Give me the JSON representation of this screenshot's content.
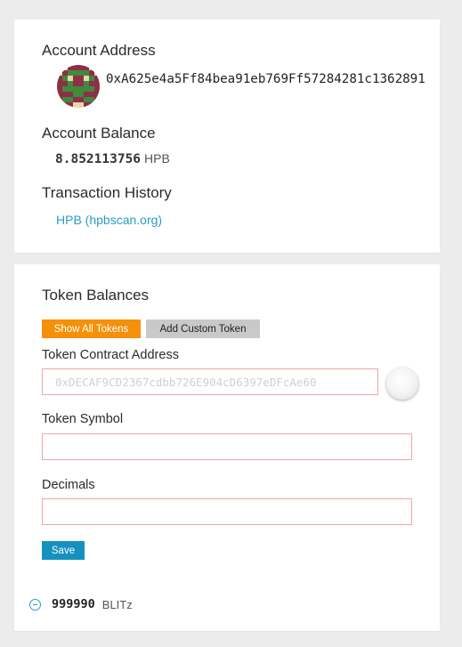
{
  "account": {
    "address_heading": "Account Address",
    "address": "0xA625e4a5Ff84bea91eb769Ff57284281c1362891",
    "balance_heading": "Account Balance",
    "balance_value": "8.852113756",
    "balance_unit": "HPB",
    "history_heading": "Transaction History",
    "history_link": "HPB (hpbscan.org)",
    "avatar_colors": [
      "#e7d8a8",
      "#8e2f48",
      "#3f8a3d"
    ]
  },
  "tokens": {
    "heading": "Token Balances",
    "show_all_label": "Show All Tokens",
    "add_custom_label": "Add Custom Token",
    "contract_label": "Token Contract Address",
    "contract_placeholder": "0xDECAF9CD2367cdbb726E904cD6397eDFcAe60",
    "symbol_label": "Token Symbol",
    "symbol_value": "",
    "decimals_label": "Decimals",
    "decimals_value": "",
    "save_label": "Save",
    "list": [
      {
        "amount": "999990",
        "symbol": "BLITz"
      }
    ]
  },
  "colors": {
    "accent_orange": "#f5900a",
    "accent_blue": "#1591bf",
    "link": "#2a9dc4",
    "field_border": "#f0a6a6"
  }
}
